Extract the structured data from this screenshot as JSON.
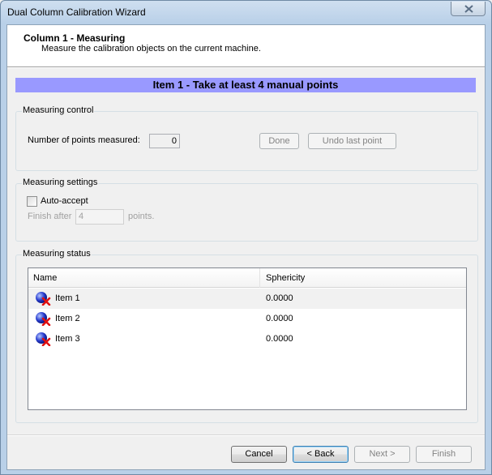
{
  "window": {
    "title": "Dual Column Calibration Wizard"
  },
  "header": {
    "title": "Column 1 - Measuring",
    "subtitle": "Measure the calibration objects on the current machine."
  },
  "banner": {
    "text": "Item 1 - Take at least 4 manual points"
  },
  "measuring_control": {
    "group_label": "Measuring control",
    "points_label": "Number of points measured:",
    "points_value": "0",
    "done_label": "Done",
    "undo_label": "Undo last point"
  },
  "measuring_settings": {
    "group_label": "Measuring settings",
    "auto_accept_label": "Auto-accept",
    "auto_accept_checked": false,
    "finish_after_label": "Finish after",
    "finish_after_value": "4",
    "points_suffix": "points."
  },
  "measuring_status": {
    "group_label": "Measuring status",
    "columns": [
      "Name",
      "Sphericity"
    ],
    "rows": [
      {
        "name": "Item 1",
        "sphericity": "0.0000",
        "icon": "sphere-error-icon"
      },
      {
        "name": "Item 2",
        "sphericity": "0.0000",
        "icon": "sphere-error-icon"
      },
      {
        "name": "Item 3",
        "sphericity": "0.0000",
        "icon": "sphere-error-icon"
      }
    ]
  },
  "footer": {
    "cancel_label": "Cancel",
    "back_label": "< Back",
    "next_label": "Next >",
    "finish_label": "Finish"
  },
  "colors": {
    "banner": "#9999ff",
    "window_frame": "#b9d0e8"
  }
}
